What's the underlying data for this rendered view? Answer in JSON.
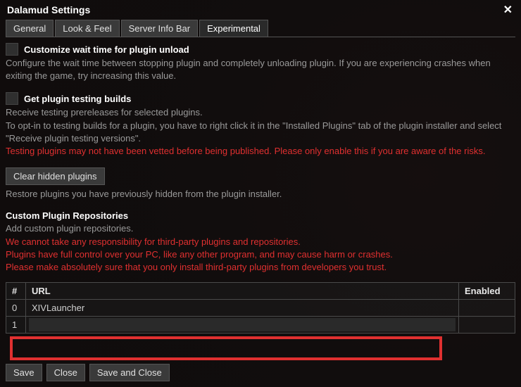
{
  "window": {
    "title": "Dalamud Settings"
  },
  "tabs": {
    "general": "General",
    "look": "Look & Feel",
    "server": "Server Info Bar",
    "experimental": "Experimental"
  },
  "unload": {
    "label": "Customize wait time for plugin unload",
    "desc": "Configure the wait time between stopping plugin and completely unloading plugin. If you are experiencing crashes when exiting the game, try increasing this value."
  },
  "testing": {
    "label": "Get plugin testing builds",
    "desc1": "Receive testing prereleases for selected plugins.",
    "desc2": "To opt-in to testing builds for a plugin, you have to right click it in the \"Installed Plugins\" tab of the plugin installer and select \"Receive plugin testing versions\".",
    "warn": "Testing plugins may not have been vetted before being published. Please only enable this if you are aware of the risks."
  },
  "hidden": {
    "button": "Clear hidden plugins",
    "desc": "Restore plugins you have previously hidden from the plugin installer."
  },
  "repos": {
    "heading": "Custom Plugin Repositories",
    "desc": "Add custom plugin repositories.",
    "warn1": "We cannot take any responsibility for third-party plugins and repositories.",
    "warn2": "Plugins have full control over your PC, like any other program, and may cause harm or crashes.",
    "warn3": "Please make absolutely sure that you only install third-party plugins from developers you trust."
  },
  "table": {
    "col_idx": "#",
    "col_url": "URL",
    "col_enabled": "Enabled",
    "rows": [
      {
        "idx": "0",
        "url": "XIVLauncher"
      },
      {
        "idx": "1",
        "url": ""
      }
    ]
  },
  "footer": {
    "save": "Save",
    "close": "Close",
    "save_close": "Save and Close"
  }
}
